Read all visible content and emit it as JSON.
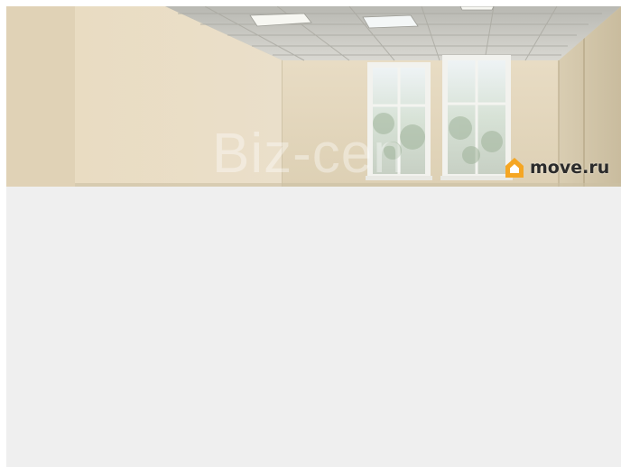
{
  "listing_photo": {
    "alt": "",
    "watermark_text": "Biz-cen",
    "brand": {
      "icon": "house-logo-icon",
      "name": "move.ru",
      "accent_color": "#f5a623"
    }
  },
  "colors": {
    "content_background": "#efefef",
    "page_background": "#ffffff"
  }
}
